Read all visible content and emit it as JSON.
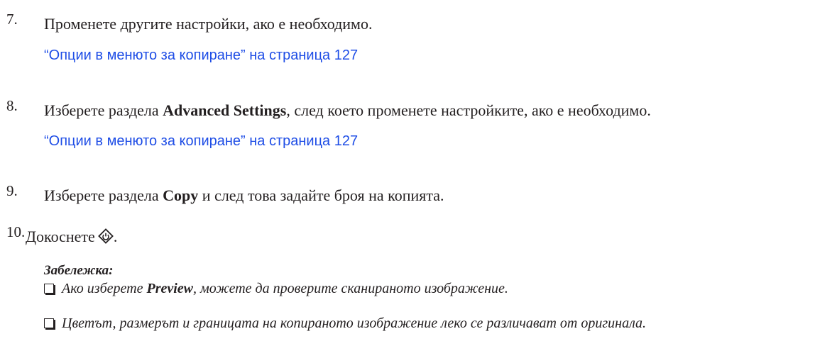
{
  "steps": [
    {
      "number": "7.",
      "text": "Променете другите настройки, ако е необходимо.",
      "link": "“Опции в менюто за копиране” на страница 127"
    },
    {
      "number": "8.",
      "prefix": "Изберете раздела ",
      "bold": "Advanced Settings",
      "suffix": ", след което променете настройките, ако е необходимо.",
      "link": "“Опции в менюто за копиране” на страница 127"
    },
    {
      "number": "9.",
      "prefix": "Изберете раздела ",
      "bold": "Copy",
      "suffix": " и след това задайте броя на копията."
    },
    {
      "number": "10.",
      "prefix": "Докоснете",
      "icon": "start-diamond-icon",
      "suffix": "."
    }
  ],
  "note": {
    "title": "Забележка:",
    "items": [
      {
        "prefix": "Ако изберете ",
        "bold": "Preview",
        "suffix": ", можете да проверите сканираното изображение."
      },
      {
        "text": "Цветът, размерът и границата на копираното изображение леко се различават от оригинала."
      }
    ]
  },
  "colors": {
    "text": "#231f20",
    "link": "#1f4ee6"
  }
}
